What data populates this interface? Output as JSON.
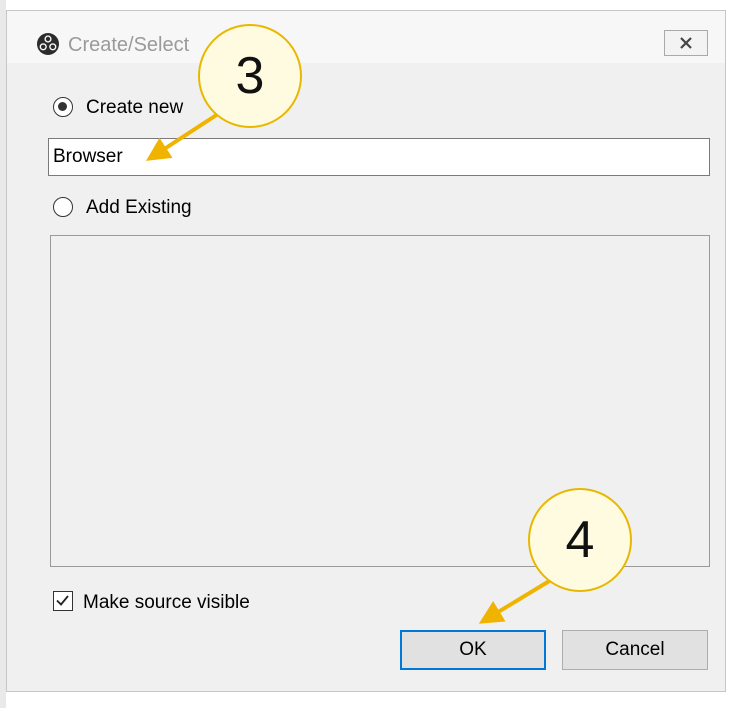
{
  "window": {
    "title": "Create/Select",
    "close_icon": "close-x-icon",
    "logo_icon": "obs-logo-icon"
  },
  "create_new": {
    "label": "Create new",
    "selected": true
  },
  "name_input": {
    "value": "Browser"
  },
  "add_existing": {
    "label": "Add Existing",
    "selected": false
  },
  "existing_list": {
    "items": []
  },
  "visibility": {
    "label": "Make source visible",
    "checked": true
  },
  "buttons": {
    "ok_label": "OK",
    "cancel_label": "Cancel"
  },
  "annotations": [
    {
      "number": "3",
      "points_to": "name-input"
    },
    {
      "number": "4",
      "points_to": "ok-button"
    }
  ],
  "colors": {
    "focus_accent": "#0078d7",
    "annotation_arrow": "#f0b400",
    "annotation_fill": "#fffbe0"
  }
}
